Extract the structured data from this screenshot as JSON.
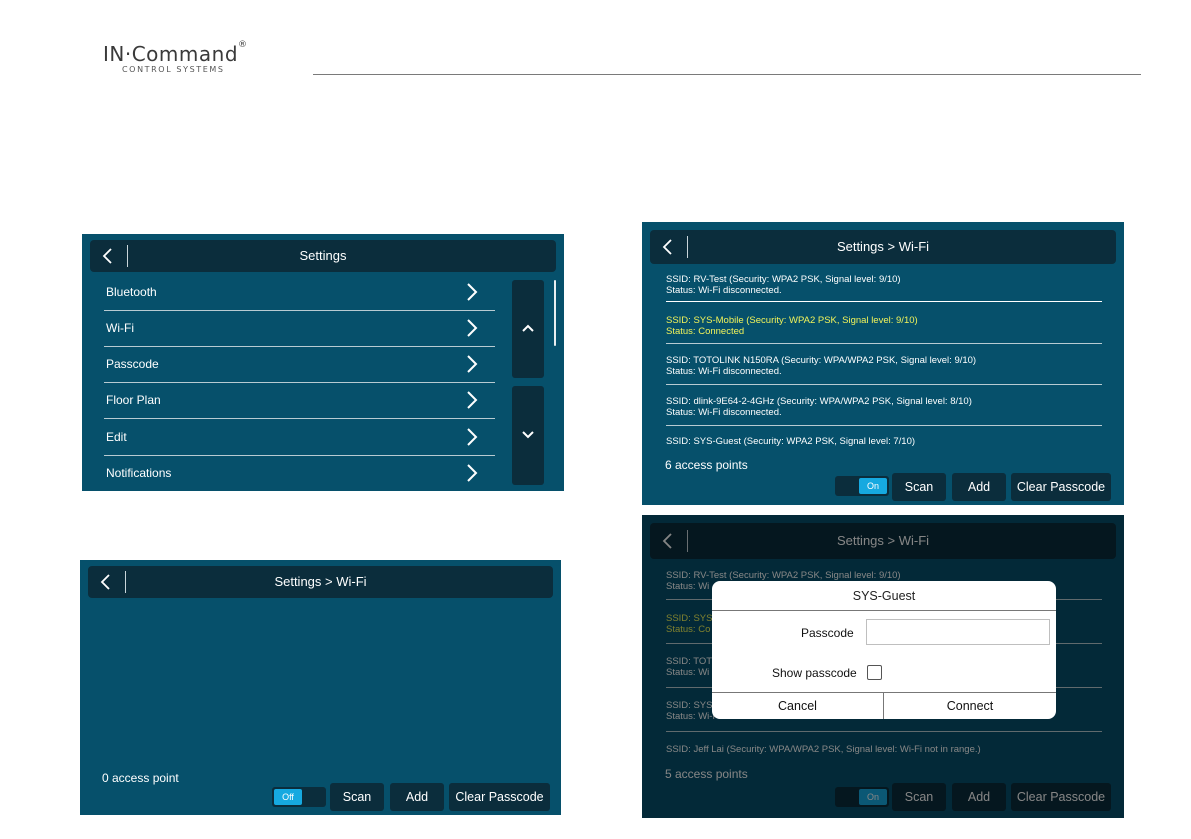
{
  "brand": {
    "name": "IN·Command",
    "registered": "®",
    "tagline": "CONTROL SYSTEMS"
  },
  "screens": {
    "settings": {
      "title": "Settings",
      "items": [
        {
          "label": "Bluetooth"
        },
        {
          "label": "Wi-Fi"
        },
        {
          "label": "Passcode"
        },
        {
          "label": "Floor Plan"
        },
        {
          "label": "Edit"
        },
        {
          "label": "Notifications"
        }
      ]
    },
    "wifi_off": {
      "title": "Settings > Wi-Fi",
      "count": "0 access point",
      "toggle": {
        "label": "Off",
        "state": "off"
      },
      "buttons": {
        "scan": "Scan",
        "add": "Add",
        "clear": "Clear Passcode"
      }
    },
    "wifi_on": {
      "title": "Settings > Wi-Fi",
      "networks": [
        {
          "ssid": "SSID: RV-Test (Security: WPA2 PSK, Signal level: 9/10)",
          "status": "Status: Wi-Fi disconnected."
        },
        {
          "ssid": "SSID: SYS-Mobile (Security: WPA2 PSK, Signal level: 9/10)",
          "status": "Status: Connected"
        },
        {
          "ssid": "SSID: TOTOLINK N150RA (Security: WPA/WPA2 PSK, Signal level: 9/10)",
          "status": "Status: Wi-Fi disconnected."
        },
        {
          "ssid": "SSID: dlink-9E64-2-4GHz (Security: WPA/WPA2 PSK, Signal level: 8/10)",
          "status": "Status: Wi-Fi disconnected."
        },
        {
          "ssid": "SSID: SYS-Guest (Security: WPA2 PSK, Signal level: 7/10)",
          "status": ""
        }
      ],
      "count": "6 access points",
      "toggle": {
        "label": "On",
        "state": "on"
      },
      "buttons": {
        "scan": "Scan",
        "add": "Add",
        "clear": "Clear Passcode"
      }
    },
    "wifi_dialog": {
      "title": "Settings > Wi-Fi",
      "networks": [
        {
          "ssid": "SSID: RV-Test (Security: WPA2 PSK, Signal level: 9/10)",
          "status": "Status: Wi"
        },
        {
          "ssid": "SSID: SYS",
          "status": "Status: Co"
        },
        {
          "ssid": "SSID: TOTO",
          "status": "Status: Wi"
        },
        {
          "ssid": "SSID: SYS",
          "status": "Status: Wi-Fi disconnected."
        },
        {
          "ssid": "SSID: Jeff Lai (Security: WPA/WPA2 PSK, Signal level: Wi-Fi not in range.)",
          "status": ""
        }
      ],
      "count": "5 access points",
      "toggle": {
        "label": "On",
        "state": "on"
      },
      "buttons": {
        "scan": "Scan",
        "add": "Add",
        "clear": "Clear Passcode"
      },
      "dialog": {
        "title": "SYS-Guest",
        "passcode_label": "Passcode",
        "passcode_value": "",
        "show_label": "Show passcode",
        "show_checked": false,
        "cancel": "Cancel",
        "connect": "Connect"
      }
    }
  },
  "colors": {
    "panel_bg": "#06506b",
    "bar_bg": "#0b2d3c",
    "toggle_accent": "#16a9e0",
    "connected_text": "#f1f35a"
  }
}
